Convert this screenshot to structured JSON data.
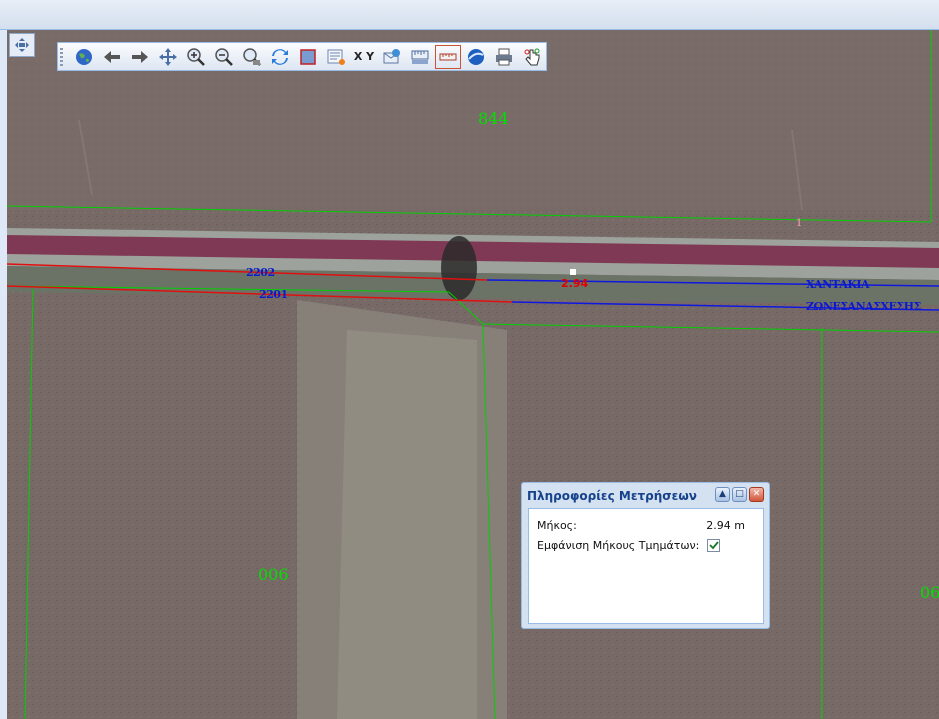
{
  "toolbar": {
    "icons": [
      "globe-icon",
      "arrow-left-icon",
      "arrow-right-icon",
      "pan-icon",
      "zoom-in-icon",
      "zoom-out-icon",
      "zoom-box-icon",
      "refresh-icon",
      "select-rect-icon",
      "identify-icon",
      "xy-goto-icon",
      "mail-icon",
      "measure-area-icon",
      "measure-length-icon",
      "google-earth-icon",
      "print-icon",
      "touch-hand-icon"
    ],
    "xy_label": "X Y"
  },
  "map": {
    "labels": {
      "parcel_844": "844",
      "parcel_006": "006",
      "parcel_06": "06",
      "road_1": "1",
      "blue_1": "ΧΑΝΤΑΚΙΑ",
      "blue_2": "ΖΩΝΕΣΑΝΑΣΧΕΣΗΣ",
      "code_a": "2202",
      "code_b": "2201",
      "measure_value": "2.94"
    },
    "colors": {
      "parcel_line": "#00d000",
      "road_band": "#8a2a55",
      "red_line": "#e01010",
      "blue_line": "#1018e0"
    }
  },
  "panel": {
    "title": "Πληροφορίες Μετρήσεων",
    "length_label": "Μήκος:",
    "length_value": "2.94 m",
    "segments_label": "Εμφάνιση Μήκους Τμημάτων:",
    "segments_checked": true
  }
}
